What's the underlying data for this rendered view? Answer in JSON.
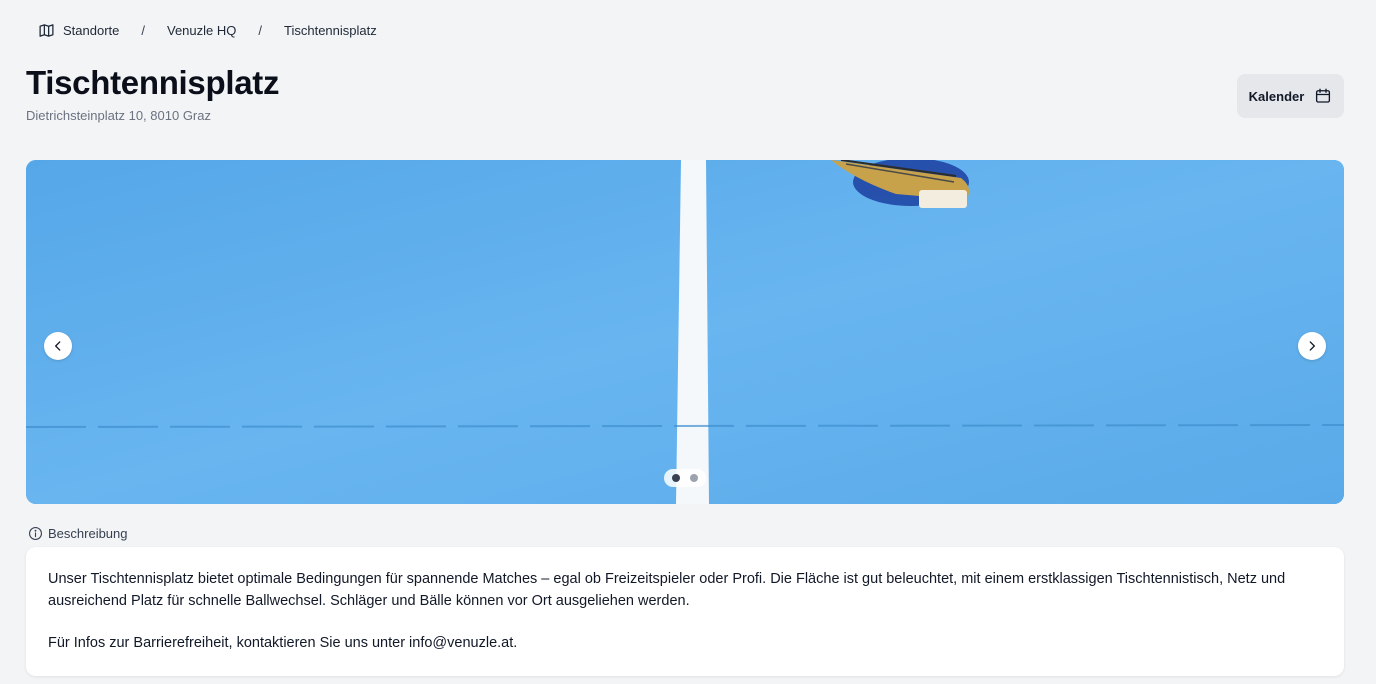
{
  "breadcrumb": {
    "icon": "map-icon",
    "items": [
      {
        "label": "Standorte"
      },
      {
        "label": "Venuzle HQ"
      },
      {
        "label": "Tischtennisplatz"
      }
    ],
    "separator": "/"
  },
  "header": {
    "title": "Tischtennisplatz",
    "address": "Dietrichsteinplatz 10, 8010 Graz",
    "calendar_button": {
      "label": "Kalender",
      "icon": "calendar-icon"
    }
  },
  "carousel": {
    "image": "table-tennis-court-photo",
    "prev_icon": "chevron-left-icon",
    "next_icon": "chevron-right-icon",
    "slides_total": 2,
    "active_slide": 1,
    "colors": {
      "court_blue": "#5aabea",
      "line_white": "#ffffff"
    }
  },
  "description": {
    "label": "Beschreibung",
    "icon": "info-icon",
    "paragraphs": [
      "Unser Tischtennisplatz bietet optimale Bedingungen für spannende Matches – egal ob Freizeitspieler oder Profi. Die Fläche ist gut beleuchtet, mit einem erstklassigen Tischtennistisch, Netz und ausreichend Platz für schnelle Ballwechsel. Schläger und Bälle können vor Ort ausgeliehen werden.",
      "Für Infos zur Barrierefreiheit, kontaktieren Sie uns unter info@venuzle.at."
    ]
  }
}
